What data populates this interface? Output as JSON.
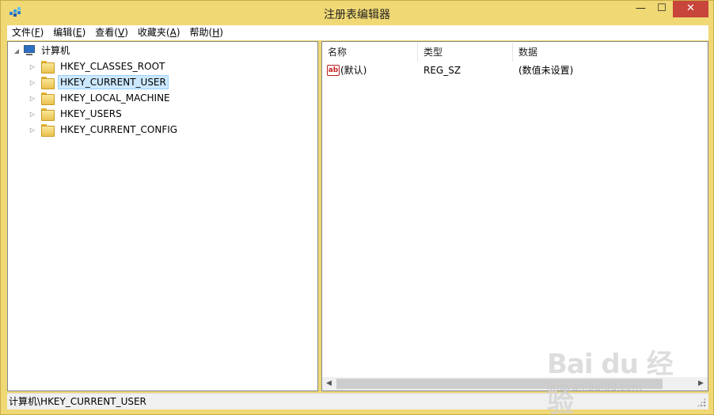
{
  "window": {
    "title": "注册表编辑器",
    "min_glyph": "—",
    "max_glyph": "☐",
    "close_glyph": "✕"
  },
  "menu": [
    {
      "label": "文件",
      "accel": "F"
    },
    {
      "label": "编辑",
      "accel": "E"
    },
    {
      "label": "查看",
      "accel": "V"
    },
    {
      "label": "收藏夹",
      "accel": "A"
    },
    {
      "label": "帮助",
      "accel": "H"
    }
  ],
  "tree": {
    "root": {
      "label": "计算机",
      "icon": "computer-icon",
      "expanded": true
    },
    "nodes": [
      {
        "label": "HKEY_CLASSES_ROOT",
        "icon": "folder-icon"
      },
      {
        "label": "HKEY_CURRENT_USER",
        "icon": "folder-icon",
        "selected": true
      },
      {
        "label": "HKEY_LOCAL_MACHINE",
        "icon": "folder-icon"
      },
      {
        "label": "HKEY_USERS",
        "icon": "folder-icon"
      },
      {
        "label": "HKEY_CURRENT_CONFIG",
        "icon": "folder-icon"
      }
    ]
  },
  "list": {
    "columns": [
      "名称",
      "类型",
      "数据"
    ],
    "rows": [
      {
        "name": "(默认)",
        "type": "REG_SZ",
        "data": "(数值未设置)",
        "icon": "string-value-icon",
        "icon_text": "ab"
      }
    ]
  },
  "status": {
    "path": "计算机\\HKEY_CURRENT_USER"
  },
  "watermark": {
    "brand": "Bai du 经验",
    "url": "jingyan.baidu.com"
  },
  "colors": {
    "frame": "#f0d874",
    "close_button": "#c7453a",
    "selection": "#cce8ff"
  }
}
